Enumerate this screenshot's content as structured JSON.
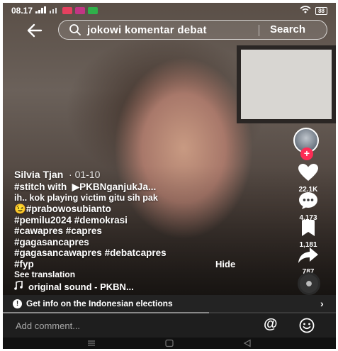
{
  "status_bar": {
    "time": "08.17",
    "battery": "88"
  },
  "search": {
    "query": "jokowi komentar debat",
    "button_label": "Search"
  },
  "creator": {
    "name": "Silvia Tjan",
    "date": "01-10"
  },
  "caption": {
    "stitch_prefix": "#stitch with",
    "stitch_user": "PKBNganjukJa...",
    "lines": [
      "ih.. kok playing victim gitu sih pak",
      "#prabowosubianto",
      "#pemilu2024 #demokrasi",
      "#cawapres #capres",
      "#gagasancapres",
      "#gagasancawapres #debatcapres",
      "#fyp"
    ],
    "hide_label": "Hide",
    "see_translation": "See translation"
  },
  "sound": {
    "label": "original sound - PKBN..."
  },
  "actions": {
    "likes": "22.1K",
    "comments": "4,173",
    "bookmarks": "1,181",
    "shares": "787"
  },
  "info_banner": {
    "text": "Get info on the Indonesian elections"
  },
  "video_progress": 0.62,
  "comment": {
    "placeholder": "Add comment..."
  },
  "colors": {
    "follow_accent": "#fe2c55",
    "bar_bg": "#1e1e1e"
  }
}
